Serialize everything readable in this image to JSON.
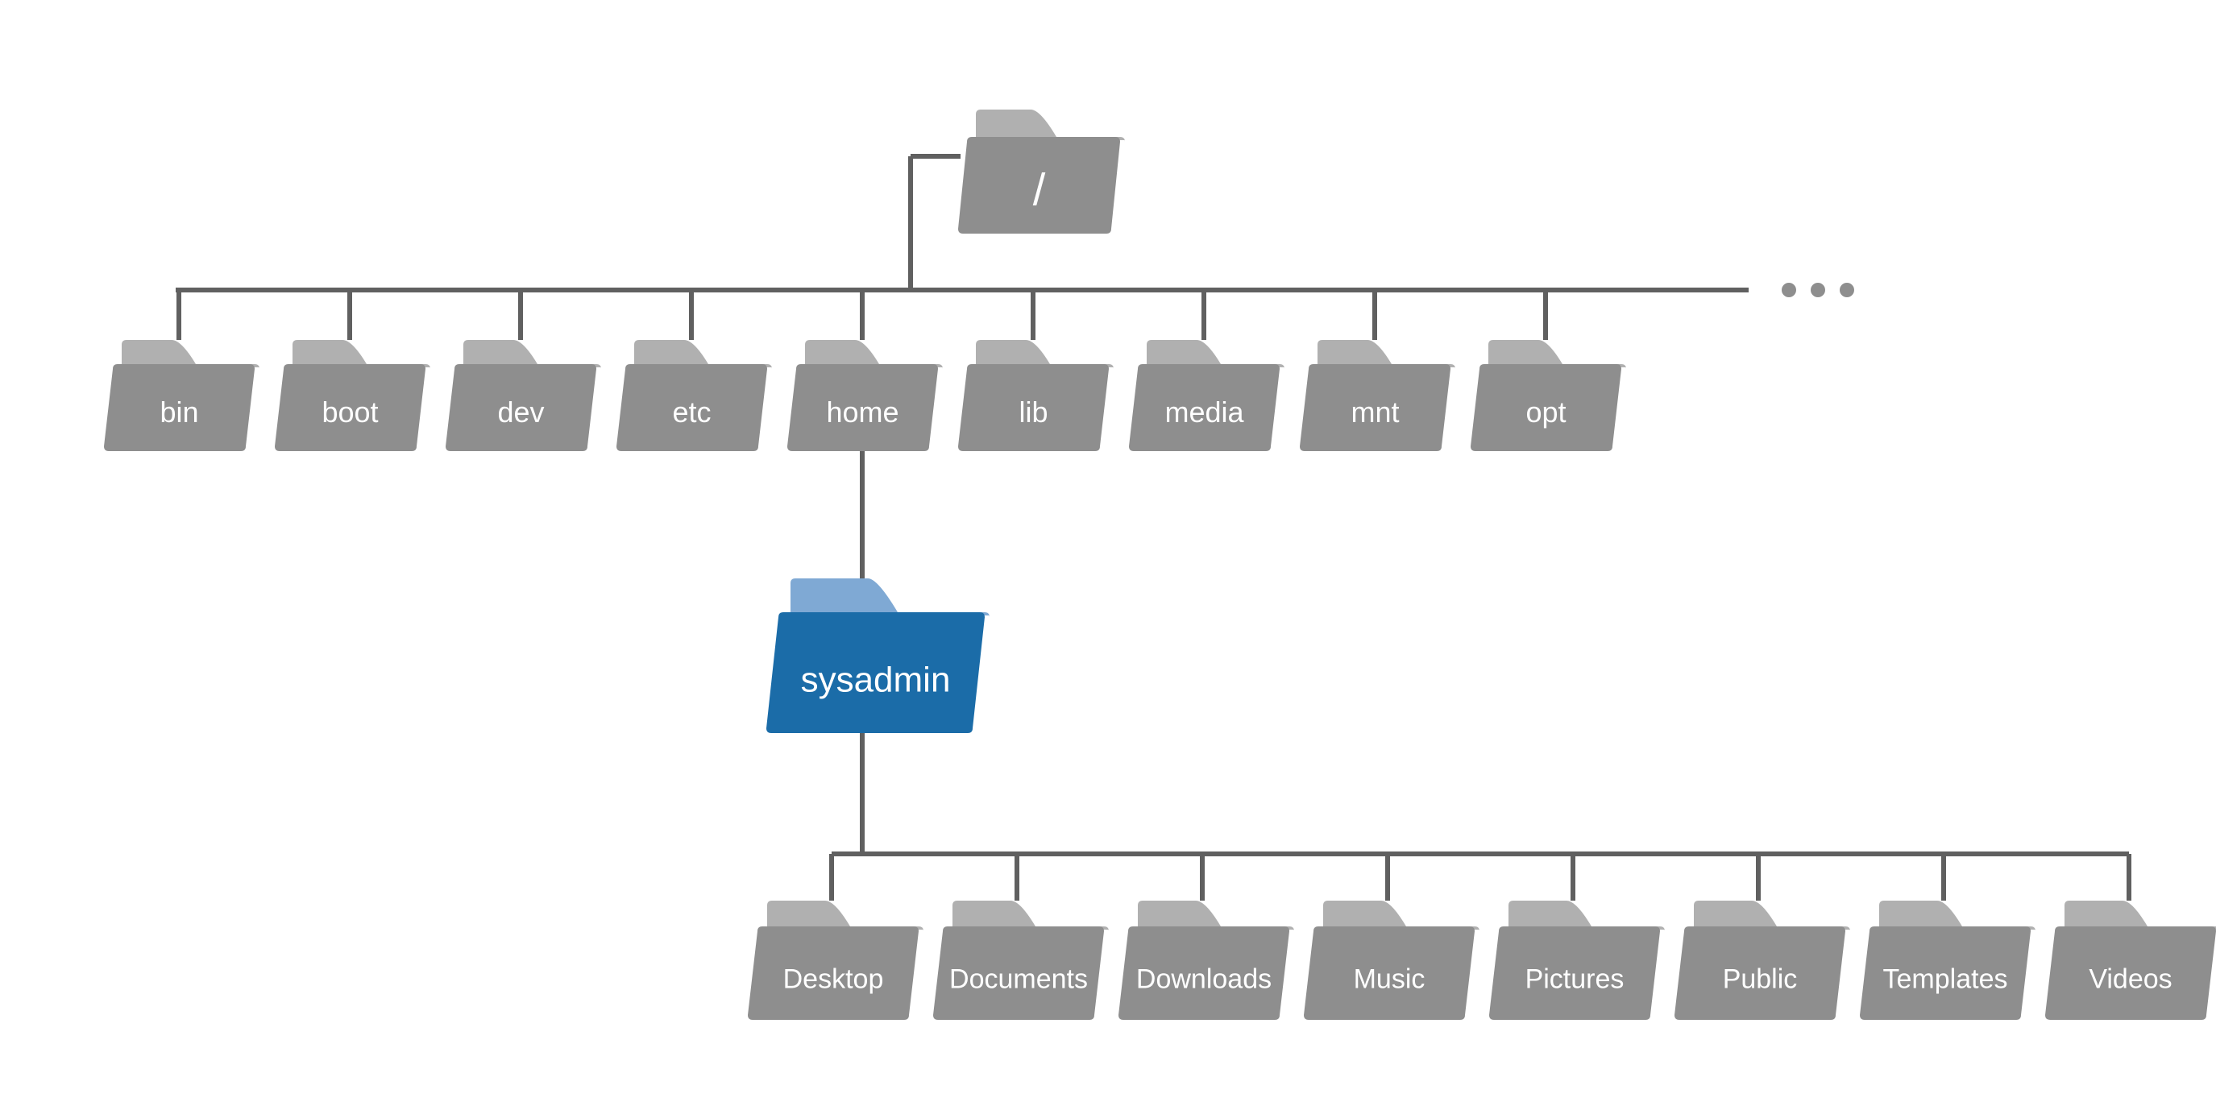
{
  "colors": {
    "line": "#606060",
    "gray_tab": "#b0b0b0",
    "gray_body": "#8e8e8e",
    "blue_tab": "#7fa9d4",
    "blue_body": "#1b6ca8",
    "ellipsis": "#8e8e8e"
  },
  "root": {
    "label": "/"
  },
  "ellipsis": "● ● ●",
  "level1": [
    {
      "label": "bin"
    },
    {
      "label": "boot"
    },
    {
      "label": "dev"
    },
    {
      "label": "etc"
    },
    {
      "label": "home"
    },
    {
      "label": "lib"
    },
    {
      "label": "media"
    },
    {
      "label": "mnt"
    },
    {
      "label": "opt"
    }
  ],
  "level2": {
    "label": "sysadmin"
  },
  "level3": [
    {
      "label": "Desktop"
    },
    {
      "label": "Documents"
    },
    {
      "label": "Downloads"
    },
    {
      "label": "Music"
    },
    {
      "label": "Pictures"
    },
    {
      "label": "Public"
    },
    {
      "label": "Templates"
    },
    {
      "label": "Videos"
    }
  ]
}
